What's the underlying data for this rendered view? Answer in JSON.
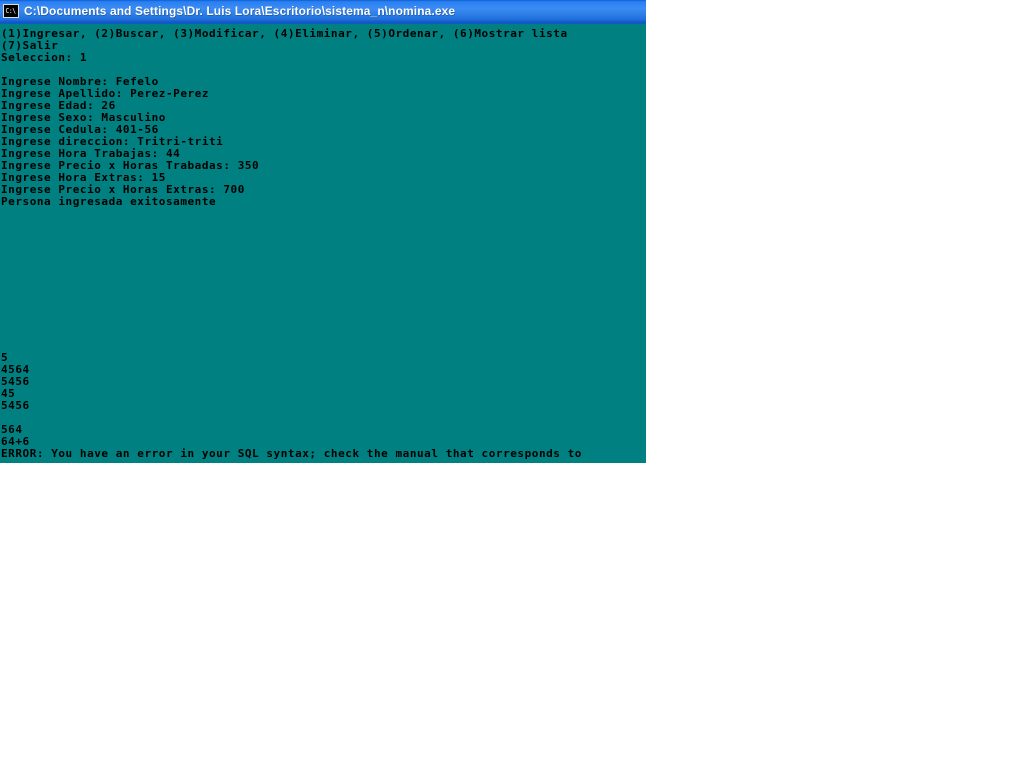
{
  "window": {
    "title": "C:\\Documents and Settings\\Dr. Luis  Lora\\Escritorio\\sistema_n\\nomina.exe",
    "icon_name": "console-window-icon",
    "icon_glyph": "C:\\",
    "titlebar_color": "#2a7ff0",
    "background_color": "#008080",
    "text_color": "#000000",
    "cursor_color": "#a33a33"
  },
  "console": {
    "lines": [
      "(1)Ingresar, (2)Buscar, (3)Modificar, (4)Eliminar, (5)Ordenar, (6)Mostrar lista",
      "(7)Salir",
      "Seleccion: 1",
      "",
      "Ingrese Nombre: Fefelo",
      "Ingrese Apellido: Perez-Perez",
      "Ingrese Edad: 26",
      "Ingrese Sexo: Masculino",
      "Ingrese Cedula: 401-56",
      "Ingrese direccion: Tritri-triti",
      "Ingrese Hora Trabajas: 44",
      "Ingrese Precio x Horas Trabadas: 350",
      "Ingrese Hora Extras: 15",
      "Ingrese Precio x Horas Extras: 700",
      "Persona ingresada exitosamente",
      "",
      "",
      "",
      "",
      "",
      "",
      "",
      "",
      "",
      "",
      "",
      "",
      "5",
      "4564",
      "5456",
      "45",
      "5456",
      "",
      "564",
      "64+6",
      "ERROR: You have an error in your SQL syntax; check the manual that corresponds to"
    ],
    "menu_options": [
      {
        "key": "1",
        "label": "Ingresar"
      },
      {
        "key": "2",
        "label": "Buscar"
      },
      {
        "key": "3",
        "label": "Modificar"
      },
      {
        "key": "4",
        "label": "Eliminar"
      },
      {
        "key": "5",
        "label": "Ordenar"
      },
      {
        "key": "6",
        "label": "Mostrar lista"
      },
      {
        "key": "7",
        "label": "Salir"
      }
    ],
    "selection": "1",
    "record": {
      "Nombre": "Fefelo",
      "Apellido": "Perez-Perez",
      "Edad": "26",
      "Sexo": "Masculino",
      "Cedula": "401-56",
      "direccion": "Tritri-triti",
      "Hora Trabajas": "44",
      "Precio x Horas Trabadas": "350",
      "Hora Extras": "15",
      "Precio x Horas Extras": "700"
    },
    "status_message": "Persona ingresada exitosamente",
    "numeric_output": [
      "5",
      "4564",
      "5456",
      "45",
      "5456",
      "564",
      "64+6"
    ],
    "error_message": "ERROR: You have an error in your SQL syntax; check the manual that corresponds to"
  }
}
